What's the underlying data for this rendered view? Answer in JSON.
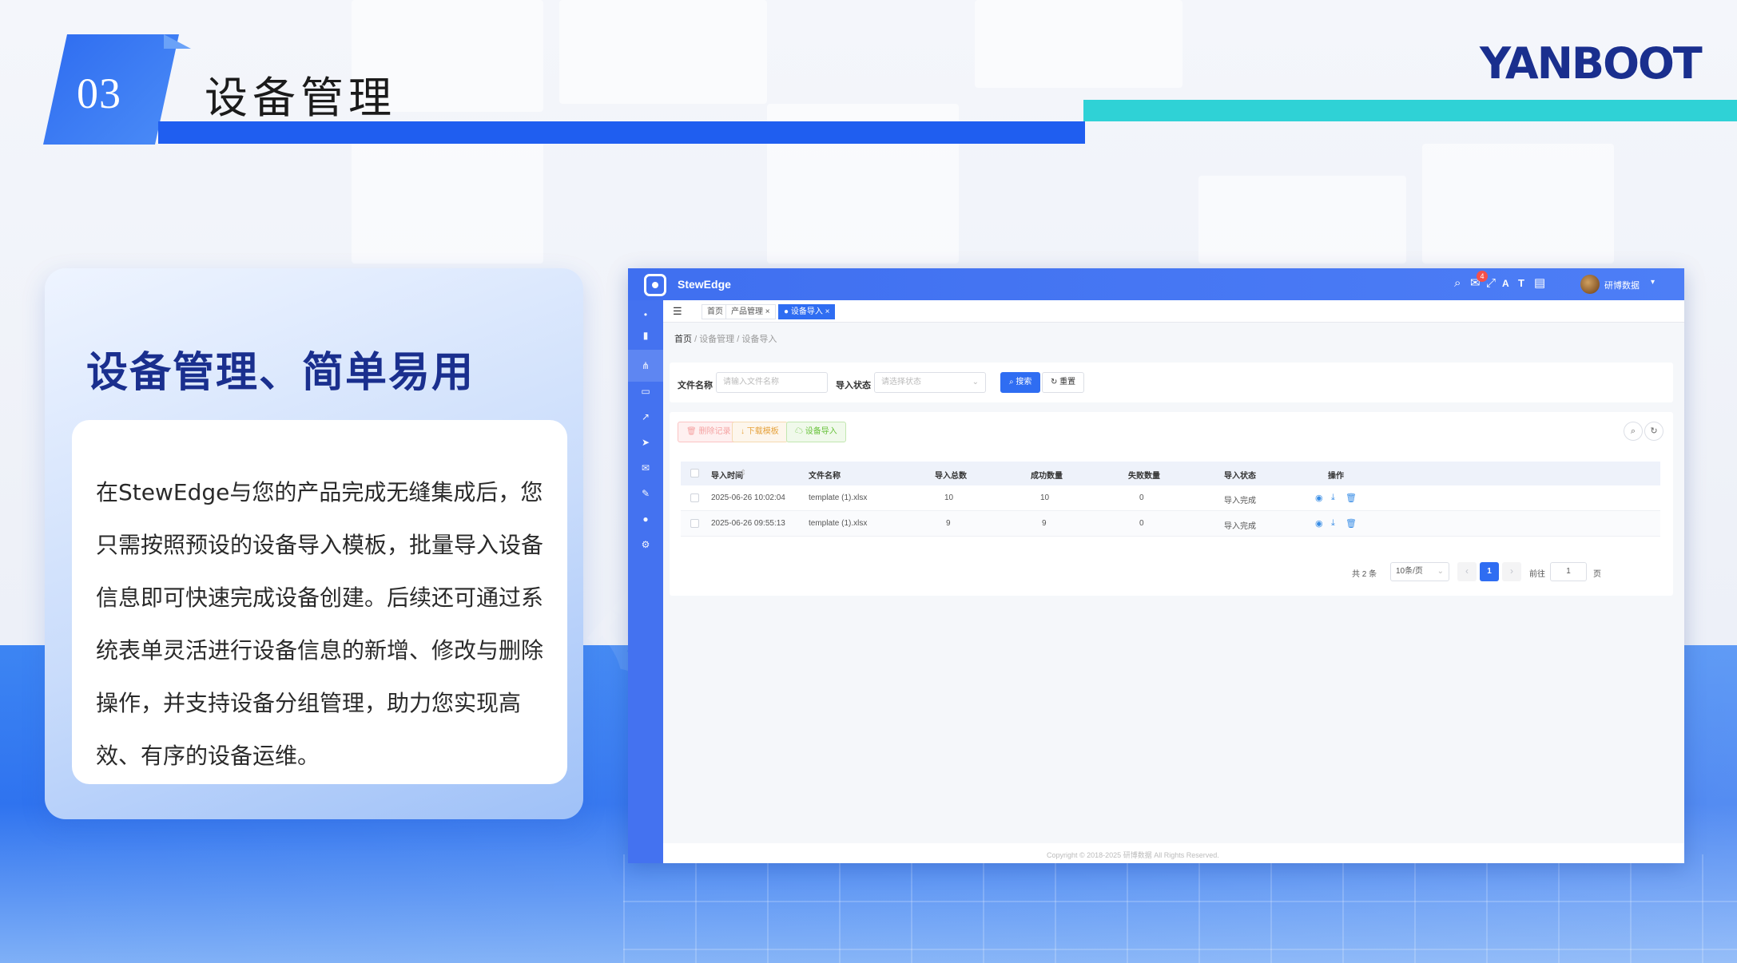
{
  "slide": {
    "number": "03",
    "title": "设备管理",
    "brand": "YANBOOT"
  },
  "card": {
    "title": "设备管理、简单易用",
    "body": "在StewEdge与您的产品完成无缝集成后，您只需按照预设的设备导入模板，批量导入设备信息即可快速完成设备创建。后续还可通过系统表单灵活进行设备信息的新增、修改与删除操作，并支持设备分组管理，助力您实现高效、有序的设备运维。"
  },
  "app": {
    "name": "StewEdge",
    "notification_count": "4",
    "user_name": "研博数据",
    "tabs": [
      {
        "label": "首页"
      },
      {
        "label": "产品管理 ×"
      },
      {
        "label": "● 设备导入 ×"
      }
    ],
    "breadcrumb": {
      "home": "首页",
      "sep1": "/",
      "level2": "设备管理",
      "sep2": "/",
      "level3": "设备导入"
    },
    "search": {
      "file_name_label": "文件名称",
      "file_name_placeholder": "请输入文件名称",
      "status_label": "导入状态",
      "status_placeholder": "请选择状态",
      "search_button": "搜索",
      "reset_button": "重置"
    },
    "toolbar": {
      "delete_button": "删除记录",
      "download_button": "下载模板",
      "import_button": "设备导入"
    },
    "table": {
      "columns": [
        "导入时间",
        "文件名称",
        "导入总数",
        "成功数量",
        "失败数量",
        "导入状态",
        "操作"
      ],
      "rows": [
        {
          "time": "2025-06-26 10:02:04",
          "file": "template (1).xlsx",
          "total": "10",
          "success": "10",
          "fail": "0",
          "status": "导入完成"
        },
        {
          "time": "2025-06-26 09:55:13",
          "file": "template (1).xlsx",
          "total": "9",
          "success": "9",
          "fail": "0",
          "status": "导入完成"
        }
      ]
    },
    "pagination": {
      "total_text": "共 2 条",
      "page_size": "10条/页",
      "current_page": "1",
      "goto_label": "前往",
      "goto_value": "1",
      "page_suffix": "页"
    },
    "footer": "Copyright © 2018-2025 研博数据 All Rights Reserved."
  },
  "colors": {
    "primary": "#2f6df2",
    "brand_navy": "#1a2f8e",
    "teal": "#2fd2d6"
  }
}
